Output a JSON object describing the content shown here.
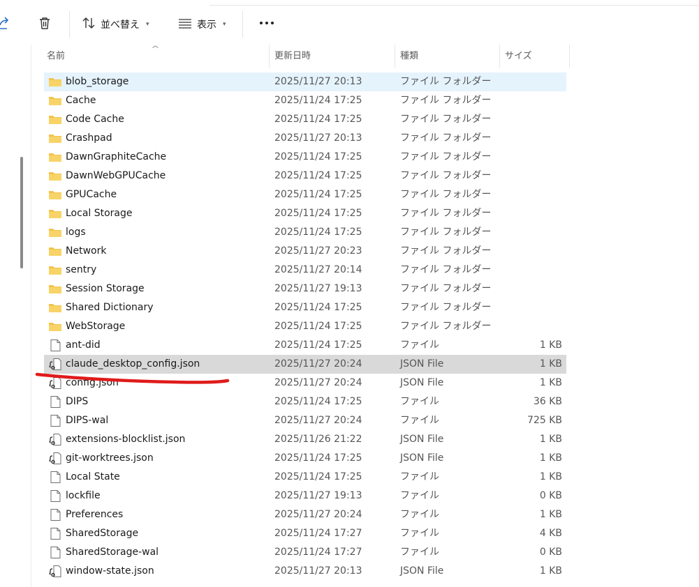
{
  "toolbar": {
    "sort_label": "並べ替え",
    "view_label": "表示"
  },
  "columns": {
    "name": "名前",
    "modified": "更新日時",
    "type": "種類",
    "size": "サイズ"
  },
  "files": [
    {
      "name": "blob_storage",
      "date": "2025/11/27 20:13",
      "type": "ファイル フォルダー",
      "size": "",
      "icon": "folder-icon"
    },
    {
      "name": "Cache",
      "date": "2025/11/24 17:25",
      "type": "ファイル フォルダー",
      "size": "",
      "icon": "folder-icon"
    },
    {
      "name": "Code Cache",
      "date": "2025/11/24 17:25",
      "type": "ファイル フォルダー",
      "size": "",
      "icon": "folder-icon"
    },
    {
      "name": "Crashpad",
      "date": "2025/11/27 20:13",
      "type": "ファイル フォルダー",
      "size": "",
      "icon": "folder-icon"
    },
    {
      "name": "DawnGraphiteCache",
      "date": "2025/11/24 17:25",
      "type": "ファイル フォルダー",
      "size": "",
      "icon": "folder-icon"
    },
    {
      "name": "DawnWebGPUCache",
      "date": "2025/11/24 17:25",
      "type": "ファイル フォルダー",
      "size": "",
      "icon": "folder-icon"
    },
    {
      "name": "GPUCache",
      "date": "2025/11/24 17:25",
      "type": "ファイル フォルダー",
      "size": "",
      "icon": "folder-icon"
    },
    {
      "name": "Local Storage",
      "date": "2025/11/24 17:25",
      "type": "ファイル フォルダー",
      "size": "",
      "icon": "folder-icon"
    },
    {
      "name": "logs",
      "date": "2025/11/24 17:25",
      "type": "ファイル フォルダー",
      "size": "",
      "icon": "folder-icon"
    },
    {
      "name": "Network",
      "date": "2025/11/27 20:23",
      "type": "ファイル フォルダー",
      "size": "",
      "icon": "folder-icon"
    },
    {
      "name": "sentry",
      "date": "2025/11/27 20:14",
      "type": "ファイル フォルダー",
      "size": "",
      "icon": "folder-icon"
    },
    {
      "name": "Session Storage",
      "date": "2025/11/27 19:13",
      "type": "ファイル フォルダー",
      "size": "",
      "icon": "folder-icon"
    },
    {
      "name": "Shared Dictionary",
      "date": "2025/11/24 17:25",
      "type": "ファイル フォルダー",
      "size": "",
      "icon": "folder-icon"
    },
    {
      "name": "WebStorage",
      "date": "2025/11/24 17:25",
      "type": "ファイル フォルダー",
      "size": "",
      "icon": "folder-icon"
    },
    {
      "name": "ant-did",
      "date": "2025/11/24 17:25",
      "type": "ファイル",
      "size": "1 KB",
      "icon": "file-icon"
    },
    {
      "name": "claude_desktop_config.json",
      "date": "2025/11/27 20:24",
      "type": "JSON File",
      "size": "1 KB",
      "icon": "json-file-icon"
    },
    {
      "name": "config.json",
      "date": "2025/11/27 20:24",
      "type": "JSON File",
      "size": "1 KB",
      "icon": "json-file-icon"
    },
    {
      "name": "DIPS",
      "date": "2025/11/24 17:25",
      "type": "ファイル",
      "size": "36 KB",
      "icon": "file-icon"
    },
    {
      "name": "DIPS-wal",
      "date": "2025/11/27 20:24",
      "type": "ファイル",
      "size": "725 KB",
      "icon": "file-icon"
    },
    {
      "name": "extensions-blocklist.json",
      "date": "2025/11/26 21:22",
      "type": "JSON File",
      "size": "1 KB",
      "icon": "json-file-icon"
    },
    {
      "name": "git-worktrees.json",
      "date": "2025/11/24 17:25",
      "type": "JSON File",
      "size": "1 KB",
      "icon": "json-file-icon"
    },
    {
      "name": "Local State",
      "date": "2025/11/24 17:25",
      "type": "ファイル",
      "size": "1 KB",
      "icon": "file-icon"
    },
    {
      "name": "lockfile",
      "date": "2025/11/27 19:13",
      "type": "ファイル",
      "size": "0 KB",
      "icon": "file-icon"
    },
    {
      "name": "Preferences",
      "date": "2025/11/27 20:24",
      "type": "ファイル",
      "size": "1 KB",
      "icon": "file-icon"
    },
    {
      "name": "SharedStorage",
      "date": "2025/11/24 17:27",
      "type": "ファイル",
      "size": "4 KB",
      "icon": "file-icon"
    },
    {
      "name": "SharedStorage-wal",
      "date": "2025/11/24 17:27",
      "type": "ファイル",
      "size": "0 KB",
      "icon": "file-icon"
    },
    {
      "name": "window-state.json",
      "date": "2025/11/27 20:13",
      "type": "JSON File",
      "size": "1 KB",
      "icon": "json-file-icon"
    }
  ],
  "state": {
    "selected_row": 0,
    "highlighted_row": 15
  },
  "colors": {
    "selected_bg": "#e5f3fd",
    "highlight_bg": "#d9d9d9",
    "folder": "#f3c24a",
    "annotation": "#e01b1b",
    "share_icon": "#2b73c7"
  }
}
